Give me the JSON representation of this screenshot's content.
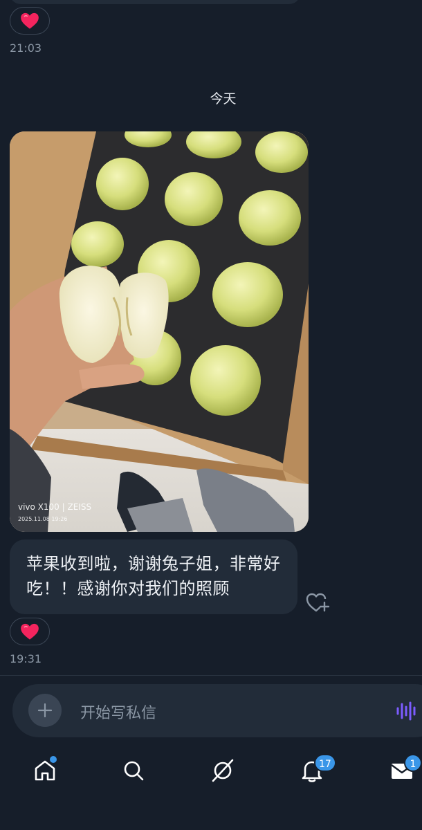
{
  "conversation": {
    "earlier_reaction": "❤️",
    "earlier_time": "21:03",
    "date_separator": "今天",
    "photo": {
      "watermark_brand": "vivo X100 | ZEISS",
      "watermark_date": "2025.11.08 19:26"
    },
    "message": {
      "text": "苹果收到啦，谢谢兔子姐，非常好吃！！感谢你对我们的照顾",
      "reaction": "❤️",
      "time": "19:31"
    }
  },
  "composer": {
    "placeholder": "开始写私信"
  },
  "tabbar": {
    "notifications_badge": "17",
    "messages_badge": "1"
  },
  "colors": {
    "background": "#161e2a",
    "bubble": "#222c39",
    "accent": "#3a96e8",
    "heart": "#f4245e",
    "voice": "#7c5cff"
  }
}
